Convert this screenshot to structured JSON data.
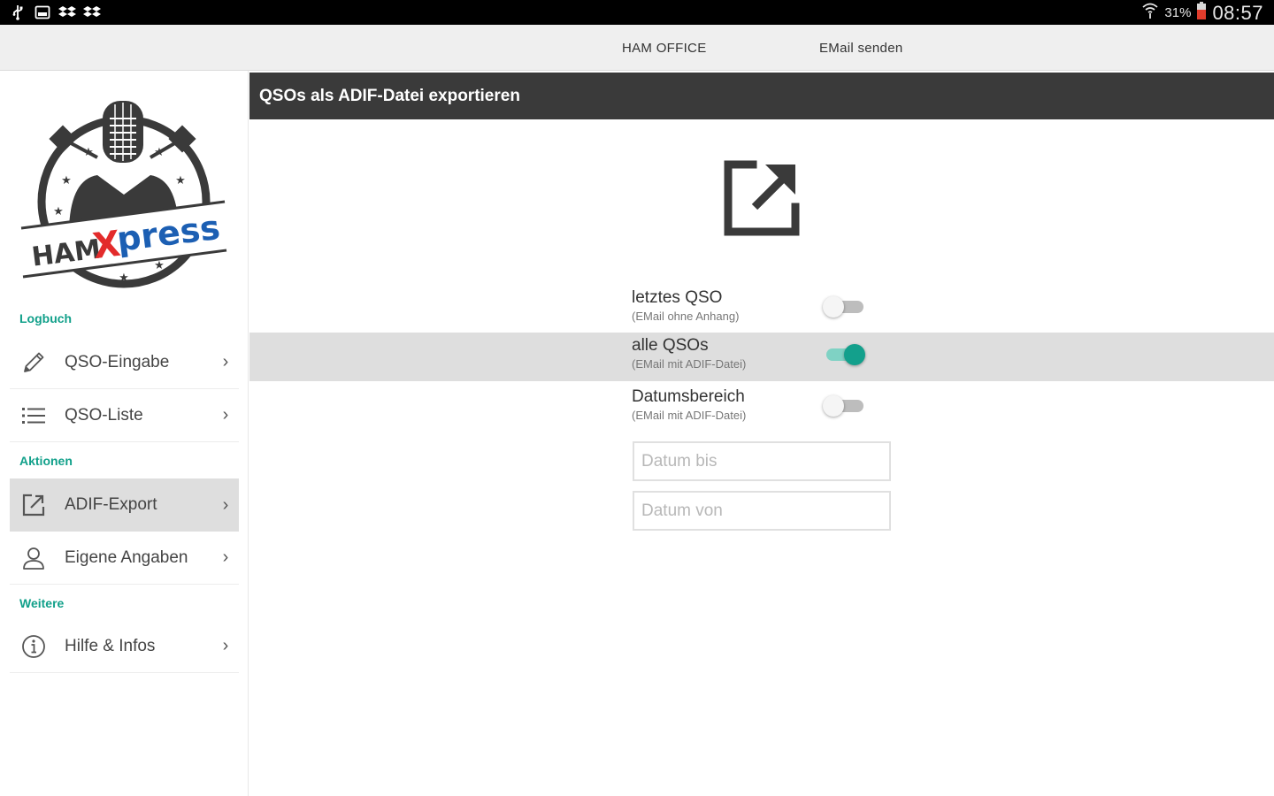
{
  "status_bar": {
    "battery_percent": "31%",
    "time": "08:57",
    "icons": [
      "usb-icon",
      "screenshot-icon",
      "dropbox-icon",
      "dropbox-icon",
      "wifi-icon",
      "battery-icon"
    ]
  },
  "topbar": {
    "items": [
      "HAM OFFICE",
      "EMail senden"
    ]
  },
  "logo": {
    "brand_ham": "HAM",
    "brand_x": "X",
    "brand_press": "press"
  },
  "sidebar": {
    "sections": {
      "logbuch": "Logbuch",
      "aktionen": "Aktionen",
      "weitere": "Weitere"
    },
    "items": [
      {
        "label": "QSO-Eingabe",
        "icon": "pencil-icon"
      },
      {
        "label": "QSO-Liste",
        "icon": "list-icon"
      },
      {
        "label": "ADIF-Export",
        "icon": "export-icon",
        "active": true
      },
      {
        "label": "Eigene Angaben",
        "icon": "person-icon"
      },
      {
        "label": "Hilfe & Infos",
        "icon": "info-icon"
      }
    ],
    "chevron": "›"
  },
  "panel": {
    "title": "QSOs als ADIF-Datei exportieren",
    "options": [
      {
        "title": "letztes QSO",
        "subtitle": "(EMail ohne Anhang)",
        "on": false
      },
      {
        "title": "alle QSOs",
        "subtitle": "(EMail mit ADIF-Datei)",
        "on": true
      },
      {
        "title": "Datumsbereich",
        "subtitle": "(EMail mit ADIF-Datei)",
        "on": false
      }
    ],
    "date_to_placeholder": "Datum bis",
    "date_from_placeholder": "Datum von"
  },
  "colors": {
    "accent": "#13a08c",
    "header_bg": "#3a3a3a",
    "logo_blue": "#1c5fb3",
    "logo_red": "#e32b2b"
  }
}
